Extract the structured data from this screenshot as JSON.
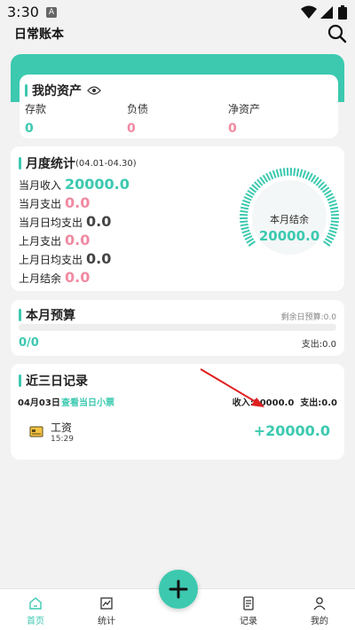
{
  "status_bar": {
    "time": "3:30",
    "app_badge": "A"
  },
  "app_bar": {
    "title": "日常账本"
  },
  "assets": {
    "title": "我的资产",
    "columns": [
      {
        "label": "存款",
        "value": "0"
      },
      {
        "label": "负债",
        "value": "0"
      },
      {
        "label": "净资产",
        "value": "0"
      }
    ]
  },
  "monthly": {
    "title": "月度统计",
    "range": "(04.01-04.30)",
    "rows": [
      {
        "label": "当月收入",
        "value": "20000.0"
      },
      {
        "label": "当月支出",
        "value": "0.0"
      },
      {
        "label": "当月日均支出",
        "value": "0.0"
      },
      {
        "label": "上月支出",
        "value": "0.0"
      },
      {
        "label": "上月日均支出",
        "value": "0.0"
      },
      {
        "label": "上月结余",
        "value": "0.0"
      }
    ],
    "gauge_label": "本月结余",
    "gauge_value": "20000.0"
  },
  "budget": {
    "title": "本月预算",
    "remaining_daily": "剩余日预算:0.0",
    "ratio": "0/0",
    "spent": "支出:0.0",
    "progress": 0
  },
  "recent": {
    "title": "近三日记录",
    "date": "04月03日",
    "receipt_link": "查看当日小票",
    "day_summary": "收入:20000.0  支出:0.0",
    "entries": [
      {
        "name": "工资",
        "time": "15:29",
        "amount": "+20000.0"
      }
    ]
  },
  "nav": {
    "items": [
      {
        "label": "首页"
      },
      {
        "label": "统计"
      },
      {
        "label": "记录"
      },
      {
        "label": "我的"
      }
    ]
  },
  "colors": {
    "accent": "#3cc9b0",
    "negative": "#f08aa2",
    "annotation": "#e02020"
  }
}
